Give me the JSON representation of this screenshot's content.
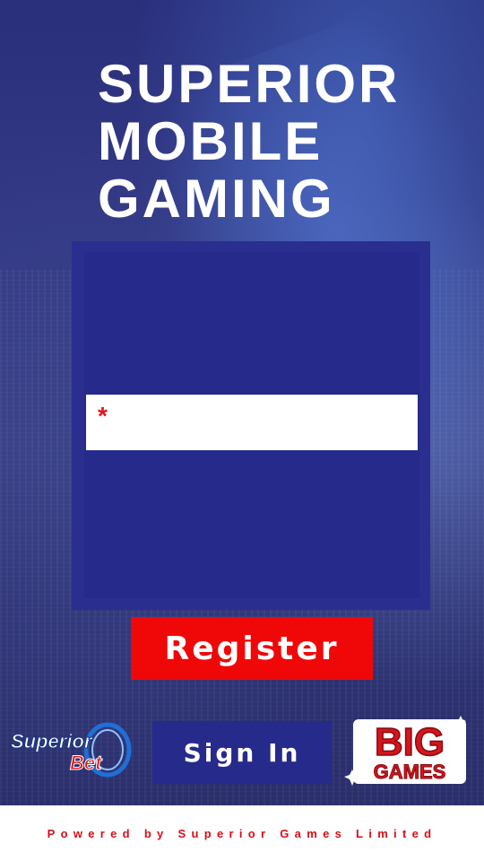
{
  "header": {
    "title_lines": [
      "SUPERIOR",
      "MOBILE",
      "GAMING"
    ]
  },
  "form": {
    "required_marker": "*",
    "field_value": ""
  },
  "actions": {
    "register_label": "Register",
    "signin_label": "Sign In"
  },
  "logos": {
    "left_line1": "Superior",
    "left_line2": "Bet",
    "right_line1": "BIG",
    "right_line2": "GAMES"
  },
  "footer": {
    "text": "Powered by Superior Games Limited"
  },
  "colors": {
    "accent_red": "#f00808",
    "panel_blue": "#262a8b",
    "footer_text": "#d90e16"
  }
}
